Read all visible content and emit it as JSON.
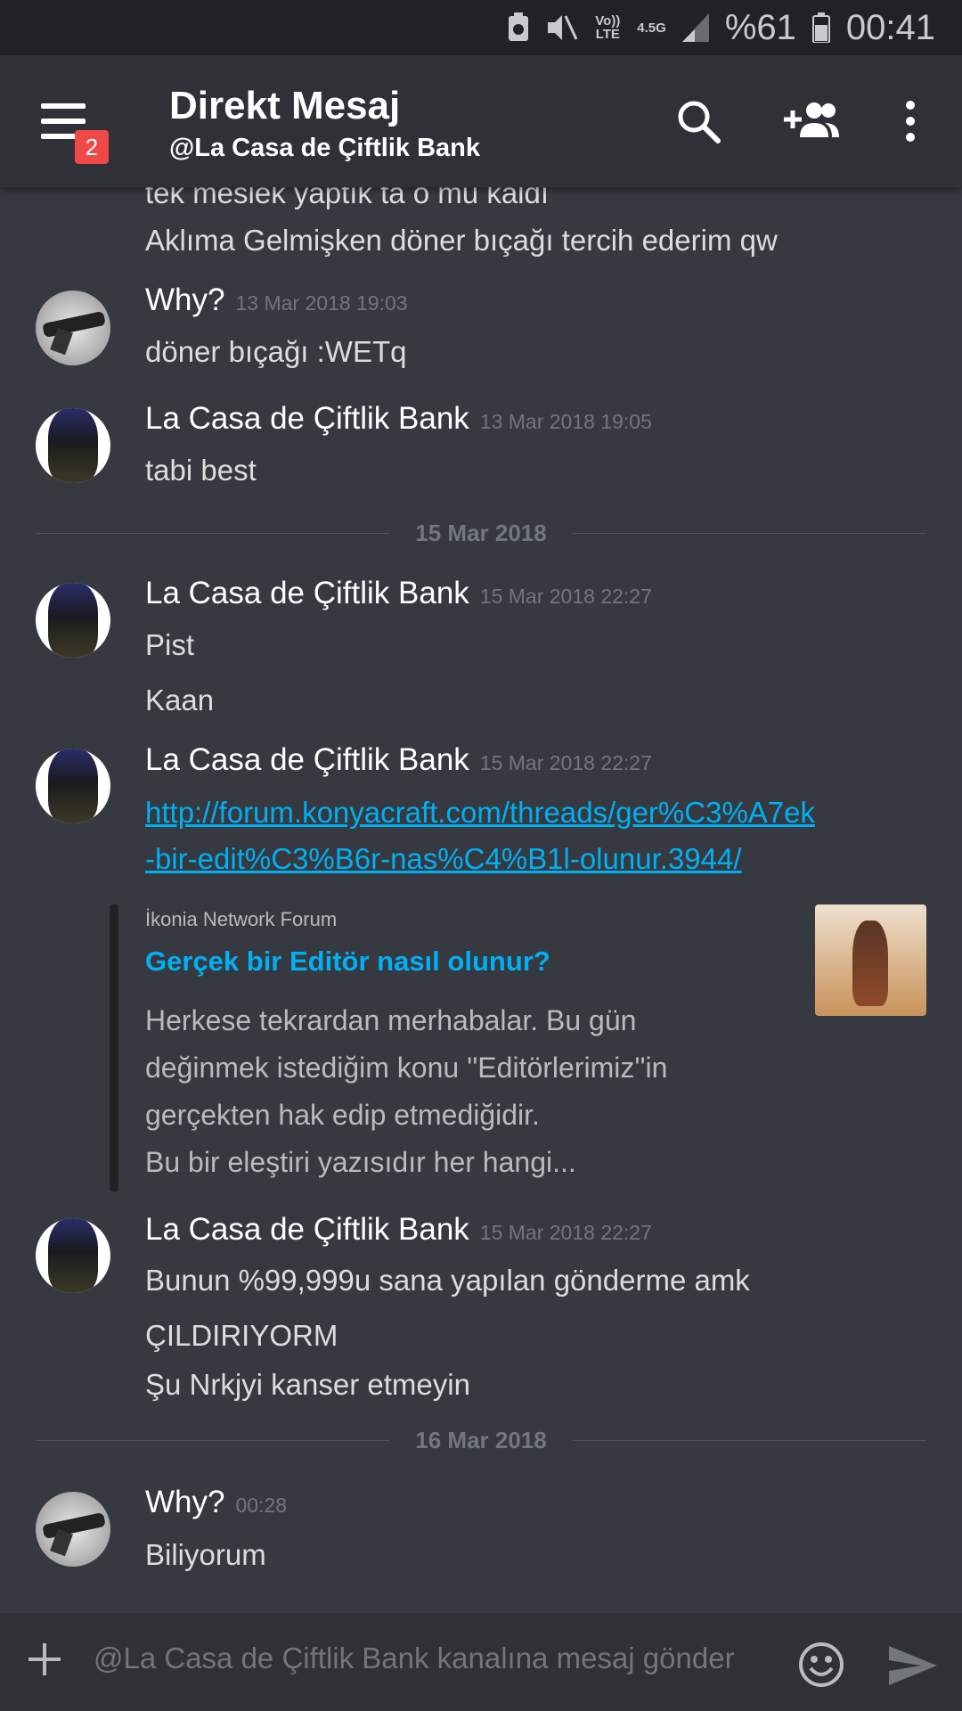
{
  "status_bar": {
    "volte": "Vo)) LTE",
    "network": "4.5G",
    "battery": "%61",
    "time": "00:41"
  },
  "header": {
    "title": "Direkt Mesaj",
    "subtitle": "@La Casa de Çiftlik Bank",
    "menu_badge": "2"
  },
  "messages": {
    "top_line1": "tek meslek yaptık ta o mu kaldı",
    "top_line2": "Aklıma Gelmişken döner bıçağı tercih ederim qw",
    "g1": {
      "author": "Why?",
      "time": "13 Mar 2018 19:03",
      "lines": [
        "döner bıçağı :WETq"
      ]
    },
    "g2": {
      "author": "La Casa de Çiftlik Bank",
      "time": "13 Mar 2018 19:05",
      "lines": [
        "tabi best"
      ]
    },
    "divider1": "15 Mar 2018",
    "g3": {
      "author": "La Casa de Çiftlik Bank",
      "time": "15 Mar 2018 22:27",
      "lines": [
        "Pist",
        "Kaan"
      ]
    },
    "g4": {
      "author": "La Casa de Çiftlik Bank",
      "time": "15 Mar 2018 22:27",
      "link_line1": "http://forum.konyacraft.com/threads/ger%C3%A7ek",
      "link_line2": "-bir-edit%C3%B6r-nas%C4%B1l-olunur.3944/",
      "embed": {
        "provider": "İkonia Network Forum",
        "title": "Gerçek bir Editör nasıl olunur?",
        "desc": [
          "Herkese tekrardan merhabalar. Bu gün",
          "değinmek istediğim konu ''Editörlerimiz''in",
          "gerçekten hak edip etmediğidir.",
          "Bu bir eleştiri yazısıdır her hangi..."
        ]
      }
    },
    "g5": {
      "author": "La Casa de Çiftlik Bank",
      "time": "15 Mar 2018 22:27",
      "lines": [
        "Bunun %99,999u sana yapılan gönderme amk",
        "ÇILDIRIYORM",
        "Şu Nrkjyi kanser etmeyin"
      ]
    },
    "divider2": "16 Mar 2018",
    "g6": {
      "author": "Why?",
      "time": "00:28",
      "lines": [
        "Biliyorum"
      ]
    }
  },
  "input": {
    "placeholder": "@La Casa de Çiftlik Bank kanalına mesaj gönder"
  },
  "colors": {
    "background": "#36393f",
    "header": "#2f3136",
    "status_bar": "#202225",
    "link": "#00b0f4",
    "badge": "#f04747"
  },
  "icons": [
    "hamburger-menu-icon",
    "search-icon",
    "add-friend-icon",
    "overflow-menu-icon",
    "plus-icon",
    "emoji-icon",
    "send-icon"
  ]
}
